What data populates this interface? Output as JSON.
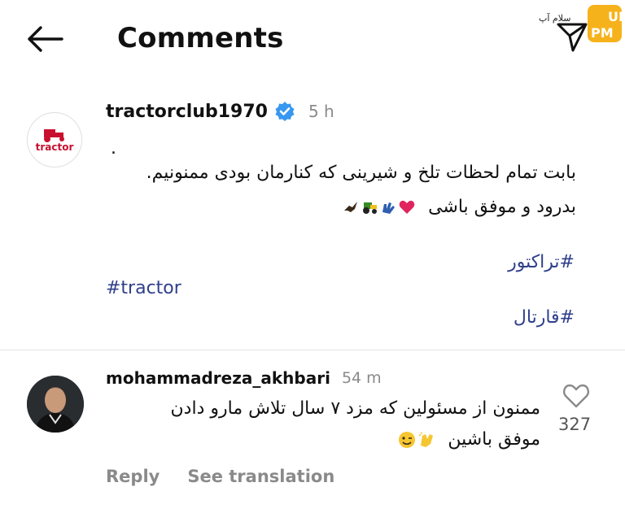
{
  "header": {
    "title": "Comments",
    "back_icon": "arrow-left-icon",
    "share_icon": "paper-plane-icon"
  },
  "brand": {
    "text": "سلام آپ",
    "badge": "UP PM",
    "color": "#f6b21b"
  },
  "post": {
    "author": "tractorclub1970",
    "verified_color": "#3897f0",
    "time": "5 h",
    "avatar_text": "tractor",
    "avatar_color": "#c8102e",
    "dot": ".",
    "line1": "بابت تمام لحظات تلخ و شیرینی که کنارمان بودی ممنونیم.",
    "line2": "بدرود و موفق باشی",
    "hashtags": [
      "#تراکتور",
      "#tractor",
      "#قارتال"
    ],
    "hashtag_color": "#2f3f8c"
  },
  "comment": {
    "author": "mohammadreza_akhbari",
    "time": "54 m",
    "line1": "ممنون از مسئولین که مزد ۷ سال تلاش مارو دادن",
    "line2": "موفق باشین",
    "like_count": "327",
    "reply_label": "Reply",
    "translate_label": "See translation"
  }
}
